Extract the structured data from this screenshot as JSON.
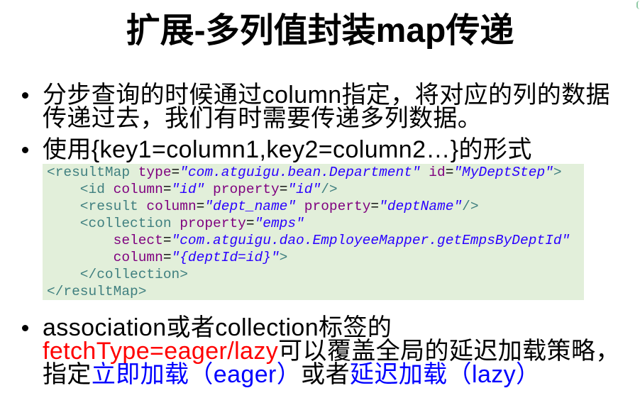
{
  "title": "扩展-多列值封装map传递",
  "colors": {
    "background": "#ffffff",
    "text": "#000000"
  },
  "bullets": [
    {
      "lines": [
        [
          {
            "text": "分步查询的时候通过column指定，将对应的列的数据"
          }
        ],
        [
          {
            "text": "传递过去，我们有时需要传递多列数据。"
          }
        ]
      ]
    },
    {
      "lines": [
        [
          {
            "text": "使用{key1=column1,key2=column2…}的形式"
          }
        ]
      ]
    },
    {
      "lines": [
        [
          {
            "text": "association或者collection标签的"
          }
        ],
        [
          {
            "text": "fetchType=eager/lazy",
            "color": "#ff0000"
          },
          {
            "text": "可以覆盖全局的延迟加载策略，"
          }
        ],
        [
          {
            "text": "指定"
          },
          {
            "text": "立即加载（eager）",
            "color": "#0000ff"
          },
          {
            "text": "或者"
          },
          {
            "text": "延迟加载（lazy）",
            "color": "#0000ff"
          }
        ]
      ]
    }
  ],
  "code": {
    "background": "#e2efda",
    "palette": {
      "tag": "#3f7f7f",
      "attr": "#7f007f",
      "eq": "#000000",
      "val": "#2a00ff"
    },
    "lines": [
      [
        {
          "tag": "<resultMap"
        },
        {
          "attr": " type"
        },
        {
          "eq": "="
        },
        {
          "val": "\"com.atguigu.bean.Department\""
        },
        {
          "attr": " id"
        },
        {
          "eq": "="
        },
        {
          "val": "\"MyDeptStep\""
        },
        {
          "tag": ">"
        }
      ],
      [
        {
          "tag": "    <id"
        },
        {
          "attr": " column"
        },
        {
          "eq": "="
        },
        {
          "val": "\"id\""
        },
        {
          "attr": " property"
        },
        {
          "eq": "="
        },
        {
          "val": "\"id\""
        },
        {
          "tag": "/>"
        }
      ],
      [
        {
          "tag": "    <result"
        },
        {
          "attr": " column"
        },
        {
          "eq": "="
        },
        {
          "val": "\"dept_name\""
        },
        {
          "attr": " property"
        },
        {
          "eq": "="
        },
        {
          "val": "\"deptName\""
        },
        {
          "tag": "/>"
        }
      ],
      [
        {
          "tag": "    <collection"
        },
        {
          "attr": " property"
        },
        {
          "eq": "="
        },
        {
          "val": "\"emps\""
        }
      ],
      [
        {
          "attr": "        select"
        },
        {
          "eq": "="
        },
        {
          "val": "\"com.atguigu.dao.EmployeeMapper.getEmpsByDeptId\""
        }
      ],
      [
        {
          "attr": "        column"
        },
        {
          "eq": "="
        },
        {
          "val": "\"{deptId=id}\""
        },
        {
          "tag": ">"
        }
      ],
      [
        {
          "tag": "    </collection>"
        }
      ],
      [
        {
          "tag": "</resultMap>"
        }
      ]
    ]
  }
}
